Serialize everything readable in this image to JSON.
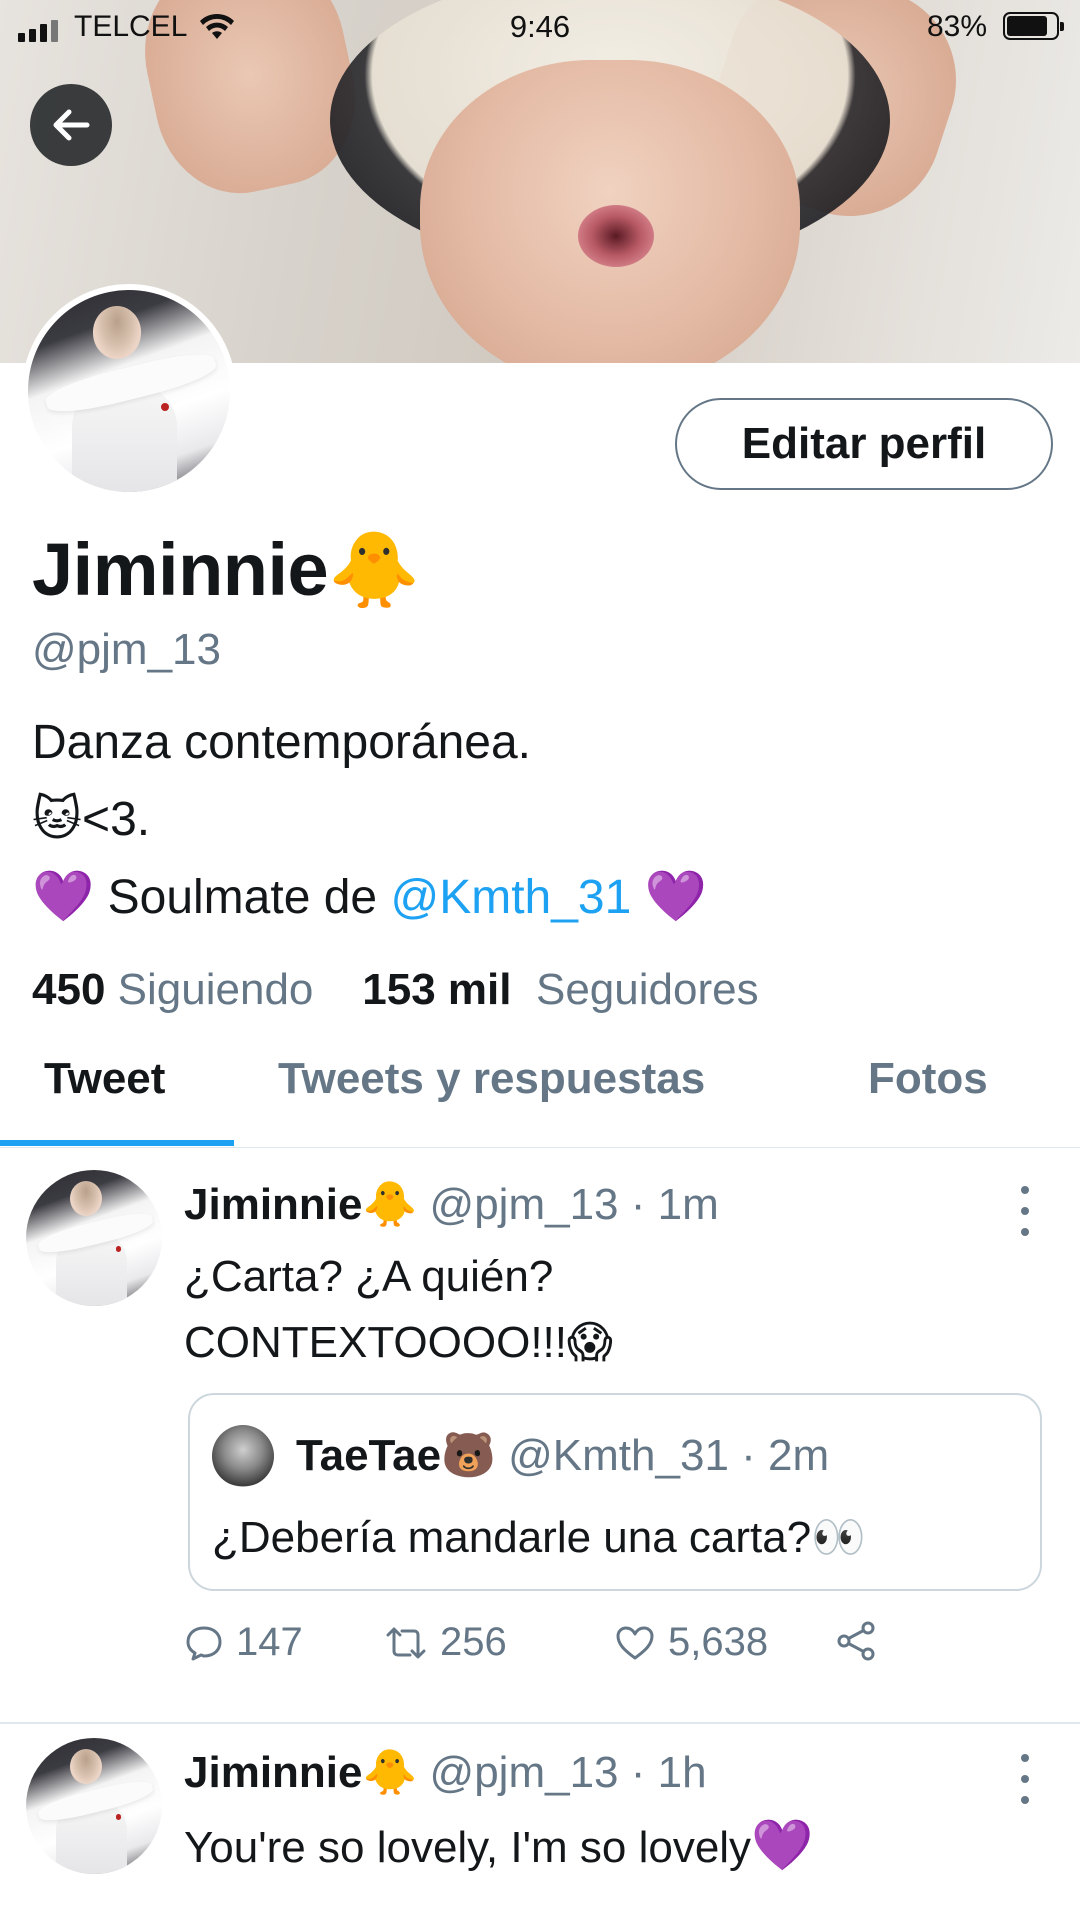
{
  "status_bar": {
    "carrier": "TELCEL",
    "time": "9:46",
    "battery_percent": "83%",
    "battery_level": 0.83
  },
  "profile": {
    "display_name": "Jiminnie",
    "display_name_emoji": "🐥",
    "handle": "@pjm_13",
    "edit_button_label": "Editar perfil",
    "bio_line1": "Danza contemporánea.",
    "bio_line2_emoji": "🐱",
    "bio_line2_text": "<3.",
    "bio_line3_heart": "💜",
    "bio_line3_text": "Soulmate de",
    "bio_line3_mention": "@Kmth_31",
    "bio_line3_heart_end": "💜",
    "following_count": "450",
    "following_label": "Siguiendo",
    "followers_count": "153 mil",
    "followers_label": "Seguidores"
  },
  "tabs": [
    {
      "label": "Tweet",
      "active": true
    },
    {
      "label": "Tweets y respuestas",
      "active": false
    },
    {
      "label": "Fotos",
      "active": false
    }
  ],
  "tweets": [
    {
      "name": "Jiminnie",
      "name_emoji": "🐥",
      "handle": "@pjm_13",
      "time": "1m",
      "text_line1": "¿Carta? ¿A quién?",
      "text_line2": "CONTEXTOOOO!!!",
      "text_line2_emoji": "😱",
      "quote": {
        "name": "TaeTae",
        "name_emoji": "🐻",
        "handle": "@Kmth_31",
        "time": "2m",
        "text": "¿Debería mandarle una carta?",
        "text_emoji": "👀"
      },
      "replies": "147",
      "retweets": "256",
      "likes": "5,638"
    },
    {
      "name": "Jiminnie",
      "name_emoji": "🐥",
      "handle": "@pjm_13",
      "time": "1h",
      "text": "You're so lovely, I'm so lovely",
      "text_emoji": "💜"
    }
  ],
  "colors": {
    "accent": "#1da1f2",
    "secondary_text": "#657786",
    "primary_text": "#14171a",
    "heart": "#9b59d9"
  },
  "icons": [
    "back-arrow-icon",
    "reply-icon",
    "retweet-icon",
    "like-icon",
    "share-icon",
    "more-icon"
  ]
}
